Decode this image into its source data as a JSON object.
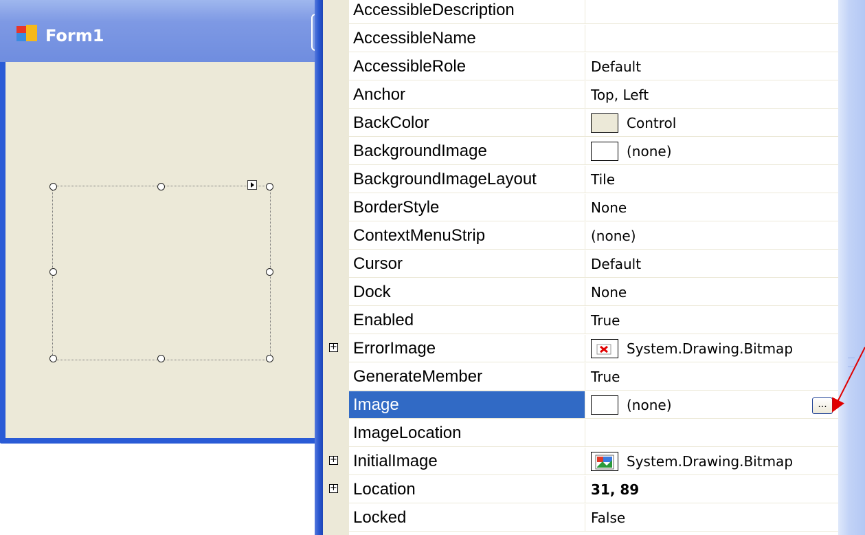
{
  "form": {
    "title": "Form1"
  },
  "properties": [
    {
      "name": "AccessibleDescription",
      "value": ""
    },
    {
      "name": "AccessibleName",
      "value": ""
    },
    {
      "name": "AccessibleRole",
      "value": "Default"
    },
    {
      "name": "Anchor",
      "value": "Top, Left"
    },
    {
      "name": "BackColor",
      "value": "Control",
      "swatch": "control"
    },
    {
      "name": "BackgroundImage",
      "value": "(none)",
      "swatch": "empty"
    },
    {
      "name": "BackgroundImageLayout",
      "value": "Tile"
    },
    {
      "name": "BorderStyle",
      "value": "None"
    },
    {
      "name": "ContextMenuStrip",
      "value": "(none)"
    },
    {
      "name": "Cursor",
      "value": "Default"
    },
    {
      "name": "Dock",
      "value": "None"
    },
    {
      "name": "Enabled",
      "value": "True"
    },
    {
      "name": "ErrorImage",
      "value": "System.Drawing.Bitmap",
      "swatch": "error-icon",
      "expandable": true,
      "expander": "+"
    },
    {
      "name": "GenerateMember",
      "value": "True"
    },
    {
      "name": "Image",
      "value": "(none)",
      "swatch": "empty",
      "selected": true,
      "ellipsis": "..."
    },
    {
      "name": "ImageLocation",
      "value": ""
    },
    {
      "name": "InitialImage",
      "value": "System.Drawing.Bitmap",
      "swatch": "image-icon",
      "expandable": true,
      "expander": "+"
    },
    {
      "name": "Location",
      "value": "31, 89",
      "bold": true,
      "expandable": true,
      "expander": "+"
    },
    {
      "name": "Locked",
      "value": "False"
    }
  ],
  "colors": {
    "selection": "#316ac5",
    "form_background": "#ece9d8",
    "annotation_arrow": "#e00000"
  }
}
